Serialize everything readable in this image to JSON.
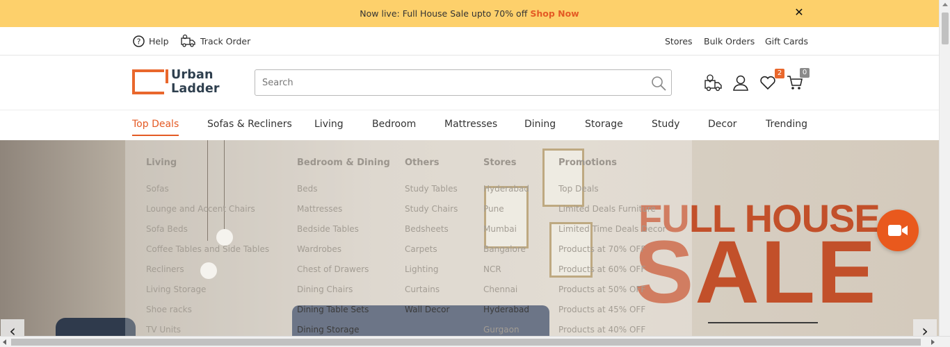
{
  "announcement": {
    "text": "Now live: Full House Sale upto 70% off",
    "link": "Shop Now"
  },
  "utility": {
    "help": "Help",
    "track_order": "Track Order",
    "stores": "Stores",
    "bulk_orders": "Bulk Orders",
    "gift_cards": "Gift Cards"
  },
  "logo": {
    "line1": "Urban",
    "line2": "Ladder"
  },
  "search": {
    "placeholder": "Search"
  },
  "header_icons": {
    "wishlist_count": "2",
    "cart_count": "0"
  },
  "nav": [
    "Top Deals",
    "Sofas & Recliners",
    "Living",
    "Bedroom",
    "Mattresses",
    "Dining",
    "Storage",
    "Study",
    "Decor",
    "Trending"
  ],
  "menu": {
    "living": {
      "title": "Living",
      "items": [
        "Sofas",
        "Lounge and Accent Chairs",
        "Sofa Beds",
        "Coffee Tables and Side Tables",
        "Recliners",
        "Living Storage",
        "Shoe racks",
        "TV Units"
      ]
    },
    "bedroom_dining": {
      "title": "Bedroom & Dining",
      "items": [
        "Beds",
        "Mattresses",
        "Bedside Tables",
        "Wardrobes",
        "Chest of Drawers",
        "Dining Chairs",
        "Dining Table Sets",
        "Dining Storage"
      ]
    },
    "others": {
      "title": "Others",
      "items": [
        "Study Tables",
        "Study Chairs",
        "Bedsheets",
        "Carpets",
        "Lighting",
        "Curtains",
        "Wall Decor"
      ]
    },
    "stores": {
      "title": "Stores",
      "items": [
        "Hyderabad",
        "Pune",
        "Mumbai",
        "Bangalore",
        "NCR",
        "Chennai",
        "Hyderabad",
        "Gurgaon"
      ]
    },
    "promotions": {
      "title": "Promotions",
      "items": [
        "Top Deals",
        "Limited Deals Furniture",
        "Limited Time Deals Decor",
        "Products at 70% OFF",
        "Products at 60% OFF",
        "Products at 50% OFF",
        "Products at 45% OFF",
        "Products at 40% OFF"
      ]
    }
  },
  "hero": {
    "line1": "FULL HOUSE",
    "line2": "SALE"
  },
  "colors": {
    "accent": "#e45a24",
    "banner": "#fdd06b",
    "sale": "#c2502a"
  }
}
